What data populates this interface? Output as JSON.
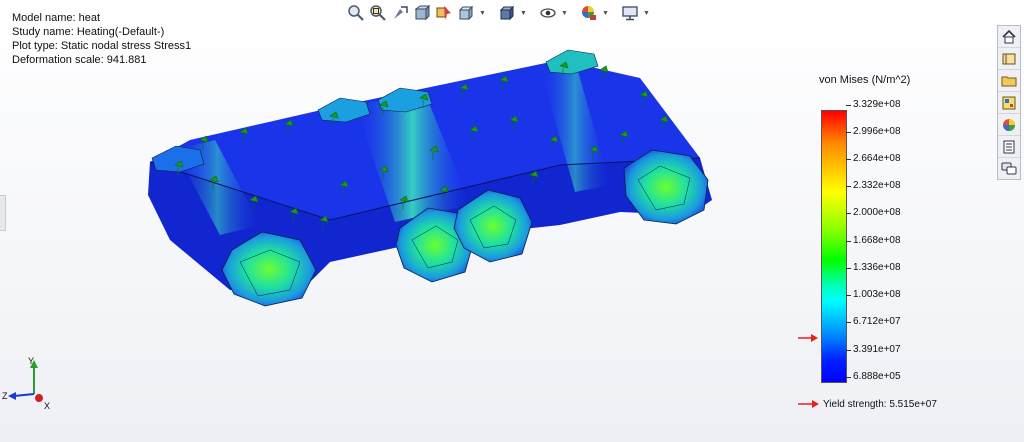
{
  "plot_info": {
    "model_name": "Model name: heat",
    "study_name": "Study name: Heating(-Default-)",
    "plot_type": "Plot type: Static nodal stress Stress1",
    "deformation_scale": "Deformation scale: 941.881"
  },
  "heads_up_toolbar": [
    {
      "icon": "zoom-to-fit-icon"
    },
    {
      "icon": "zoom-to-area-icon"
    },
    {
      "icon": "previous-view-icon"
    },
    {
      "icon": "section-view-icon"
    },
    {
      "icon": "dynamic-annotation-icon"
    },
    {
      "icon": "view-orientation-icon",
      "dropdown": true
    },
    {
      "icon": "display-style-icon",
      "dropdown": true
    },
    {
      "icon": "hide-show-items-icon",
      "dropdown": true
    },
    {
      "icon": "edit-appearance-icon",
      "dropdown": true
    },
    {
      "icon": "view-settings-icon",
      "dropdown": true
    }
  ],
  "task_pane": [
    {
      "icon": "home-icon"
    },
    {
      "icon": "design-library-icon"
    },
    {
      "icon": "file-explorer-icon"
    },
    {
      "icon": "view-palette-icon"
    },
    {
      "icon": "appearances-icon"
    },
    {
      "icon": "custom-properties-icon"
    },
    {
      "icon": "forum-icon"
    }
  ],
  "legend": {
    "title": "von Mises (N/m^2)",
    "labels": [
      "3.329e+08",
      "2.996e+08",
      "2.664e+08",
      "2.332e+08",
      "2.000e+08",
      "1.668e+08",
      "1.336e+08",
      "1.003e+08",
      "6.712e+07",
      "3.391e+07",
      "6.888e+05"
    ],
    "max_color": "#ff0000",
    "min_color": "#0000ff",
    "marker_color": "#e8201b",
    "yield_label": "Yield strength: 5.515e+07"
  },
  "triad": {
    "x": "X",
    "y": "Y",
    "z": "Z"
  },
  "colors": {
    "model_body": "#1a2ee0",
    "fixture": "#1a9a1a",
    "accent": "#0a3bd6"
  }
}
